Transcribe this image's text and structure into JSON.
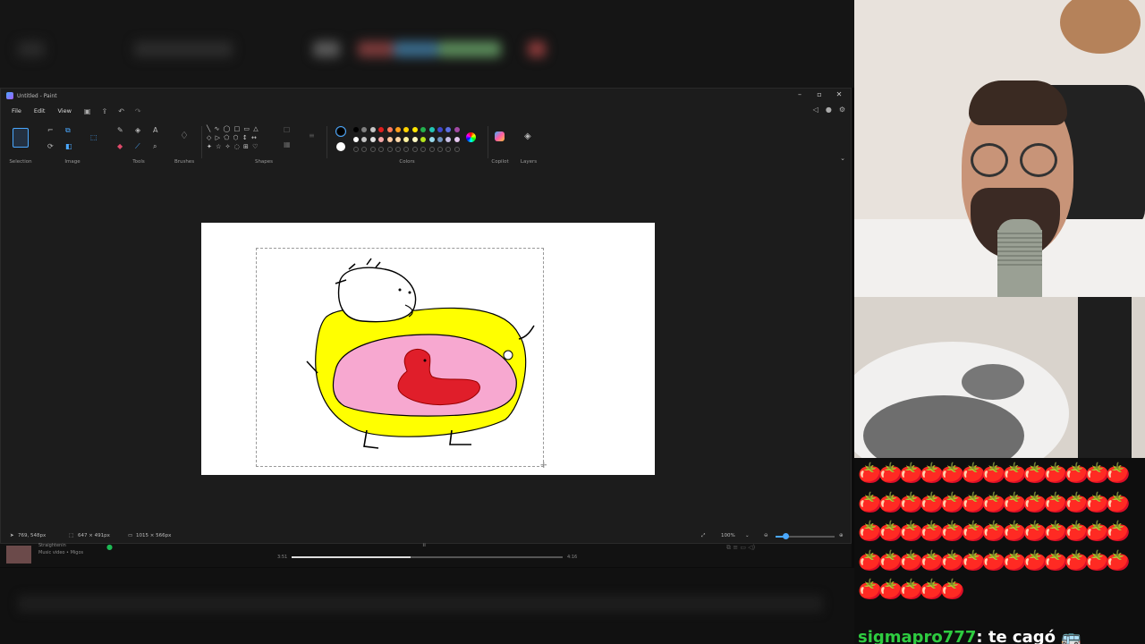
{
  "paint": {
    "window_title": "Untitled - Paint",
    "menu": [
      "File",
      "Edit",
      "View"
    ],
    "ribbon_groups": [
      "Selection",
      "Image",
      "Tools",
      "Brushes",
      "Shapes",
      "Colors",
      "Copilot",
      "Layers"
    ],
    "palette_row1": [
      "#000000",
      "#7f7f7f",
      "#c3c3c3",
      "#e01e1e",
      "#ff7a5a",
      "#ff9f1c",
      "#ffd400",
      "#ffe600",
      "#23b14d",
      "#22c3b3",
      "#3f48cc",
      "#5b6ee1",
      "#a349a4"
    ],
    "palette_row2": [
      "#ffffff",
      "#c3c3c3",
      "#e0e0e0",
      "#f4a7a7",
      "#ffc9a0",
      "#ffd8a8",
      "#fff3a0",
      "#fff9c4",
      "#b5e61d",
      "#99d9ea",
      "#7092be",
      "#c8bfe7",
      "#e6c7f0"
    ],
    "primary_color": "#000000",
    "secondary_color": "#ffffff",
    "status": {
      "cursor": "769, 548px",
      "selection_size": "647 × 491px",
      "canvas_size": "1015 × 566px",
      "zoom": "100%"
    }
  },
  "player": {
    "track": "Straightenin",
    "subtitle": "Music video • Migos",
    "elapsed": "3:51",
    "duration": "4:16",
    "progress": 0.44
  },
  "chat": {
    "emote_count": 57,
    "message_user": "sigmapro777",
    "message_text": "te cagó 🚌"
  }
}
